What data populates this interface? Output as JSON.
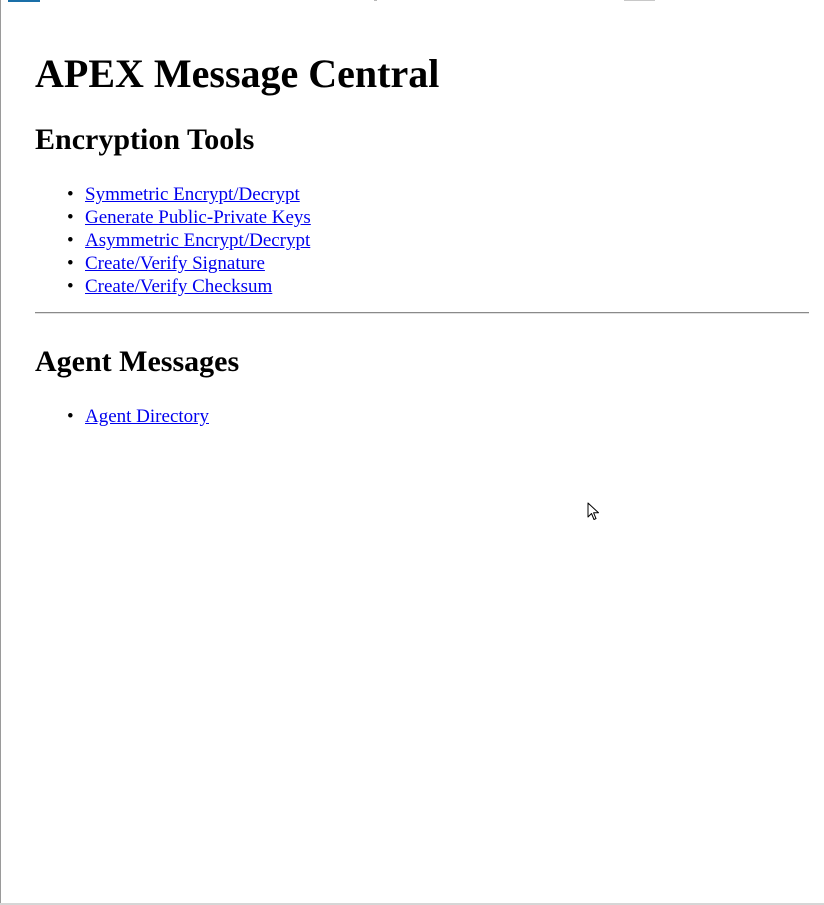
{
  "page": {
    "title": "APEX Message Central"
  },
  "encryption_tools": {
    "heading": "Encryption Tools",
    "links": [
      {
        "label": "Symmetric Encrypt/Decrypt"
      },
      {
        "label": "Generate Public-Private Keys"
      },
      {
        "label": "Asymmetric Encrypt/Decrypt"
      },
      {
        "label": "Create/Verify Signature"
      },
      {
        "label": "Create/Verify Checksum"
      }
    ]
  },
  "agent_messages": {
    "heading": "Agent Messages",
    "links": [
      {
        "label": "Agent Directory"
      }
    ]
  },
  "style": {
    "link_color": "#0000ee"
  },
  "icons": {
    "bullet": "•",
    "cursor": "mouse-pointer-icon"
  }
}
